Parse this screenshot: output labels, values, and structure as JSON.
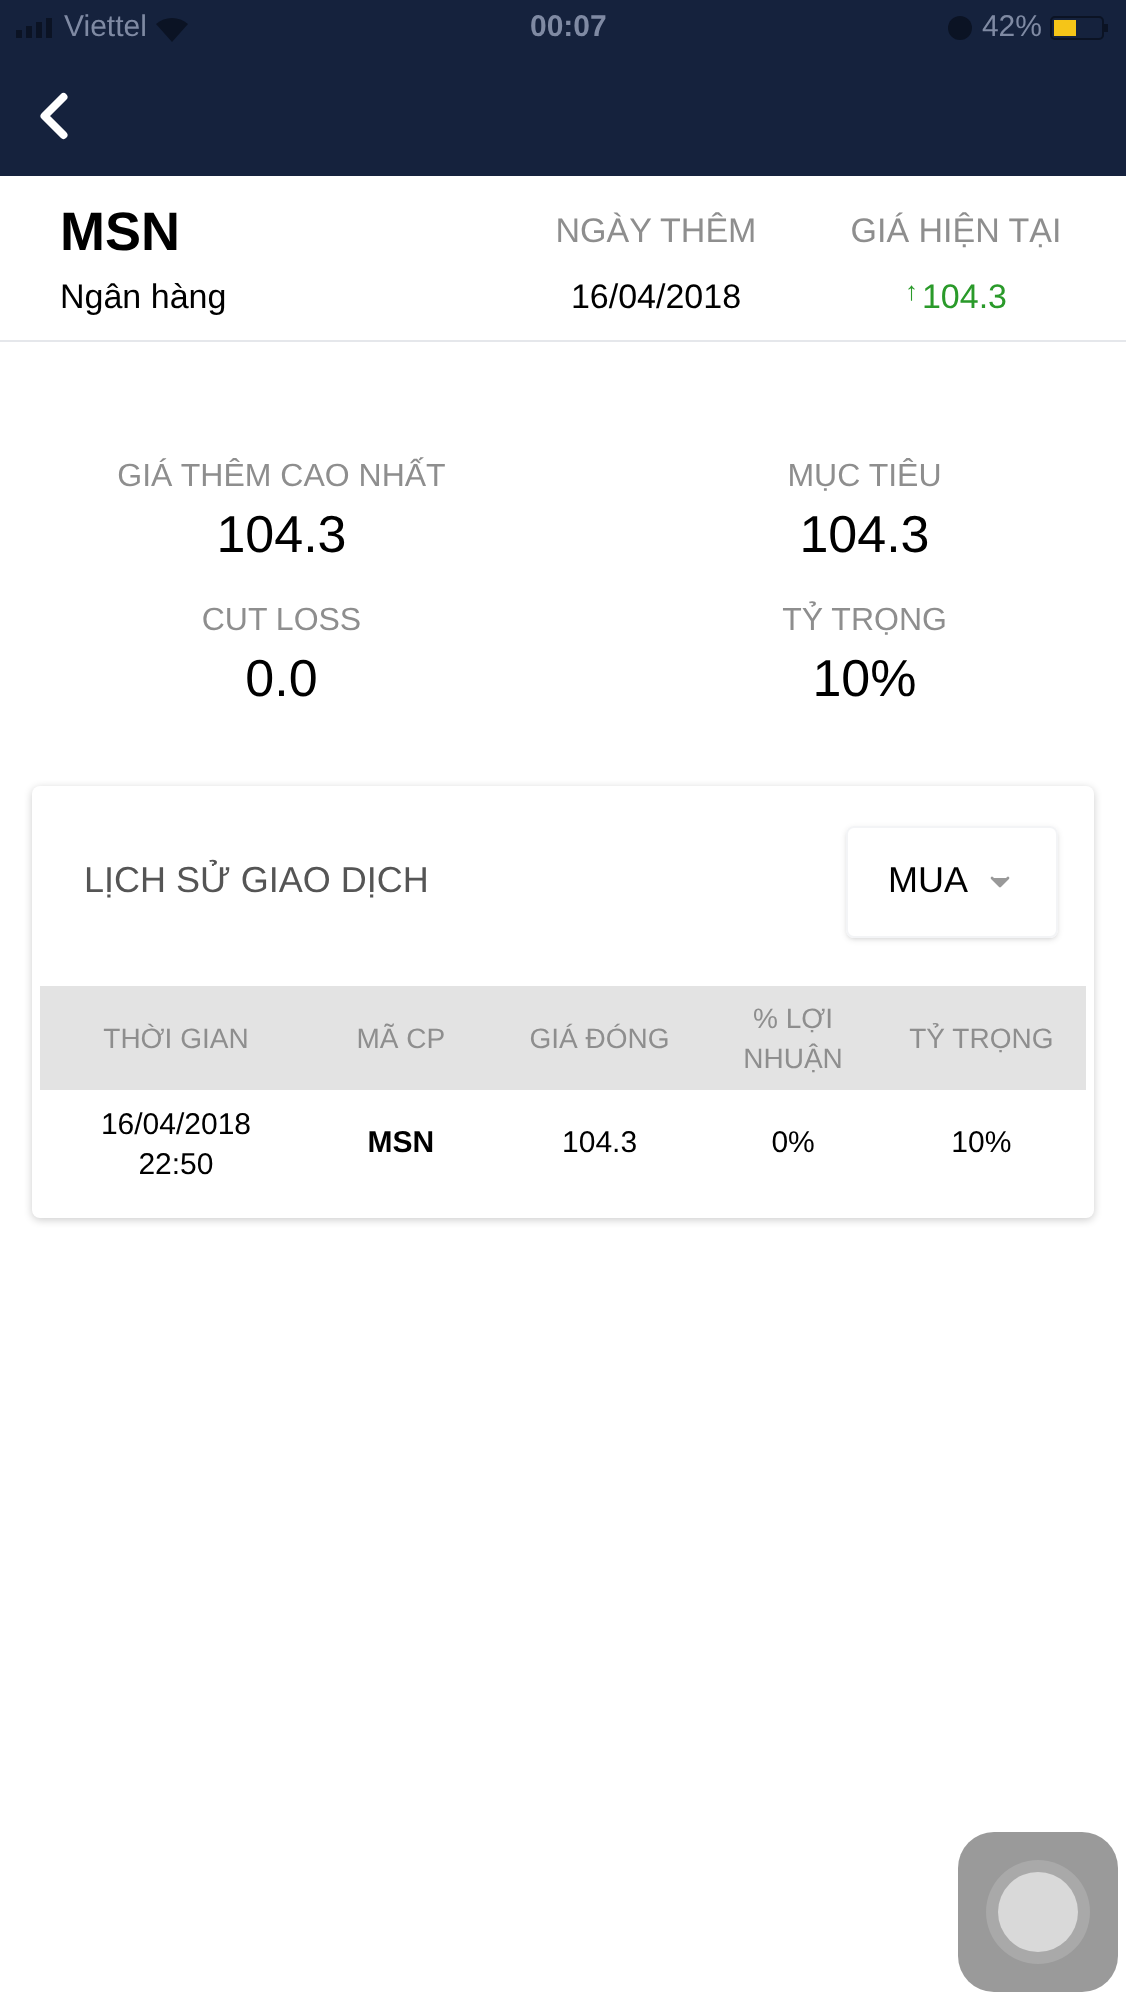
{
  "status_bar": {
    "carrier": "Viettel",
    "time": "00:07",
    "battery": "42%"
  },
  "header": {
    "symbol": "MSN",
    "sector": "Ngân hàng",
    "columns": [
      {
        "label": "NGÀY THÊM",
        "value": "16/04/2018",
        "kind": "plain"
      },
      {
        "label": "GIÁ HIỆN TẠI",
        "value": "104.3",
        "arrow": "↑",
        "kind": "up"
      }
    ]
  },
  "stats": [
    {
      "label": "GIÁ THÊM CAO NHẤT",
      "value": "104.3"
    },
    {
      "label": "MỤC TIÊU",
      "value": "104.3"
    },
    {
      "label": "CUT LOSS",
      "value": "0.0"
    },
    {
      "label": "TỶ TRỌNG",
      "value": "10%"
    }
  ],
  "history": {
    "title": "LỊCH SỬ GIAO DỊCH",
    "filter": "MUA",
    "table": {
      "columns": [
        "THỜI GIAN",
        "MÃ CP",
        "GIÁ ĐÓNG",
        "% LỢI NHUẬN",
        "TỶ TRỌNG"
      ],
      "rows": [
        {
          "date": "16/04/2018",
          "time": "22:50",
          "symbol": "MSN",
          "close": "104.3",
          "profit": "0%",
          "weight": "10%"
        }
      ]
    }
  }
}
